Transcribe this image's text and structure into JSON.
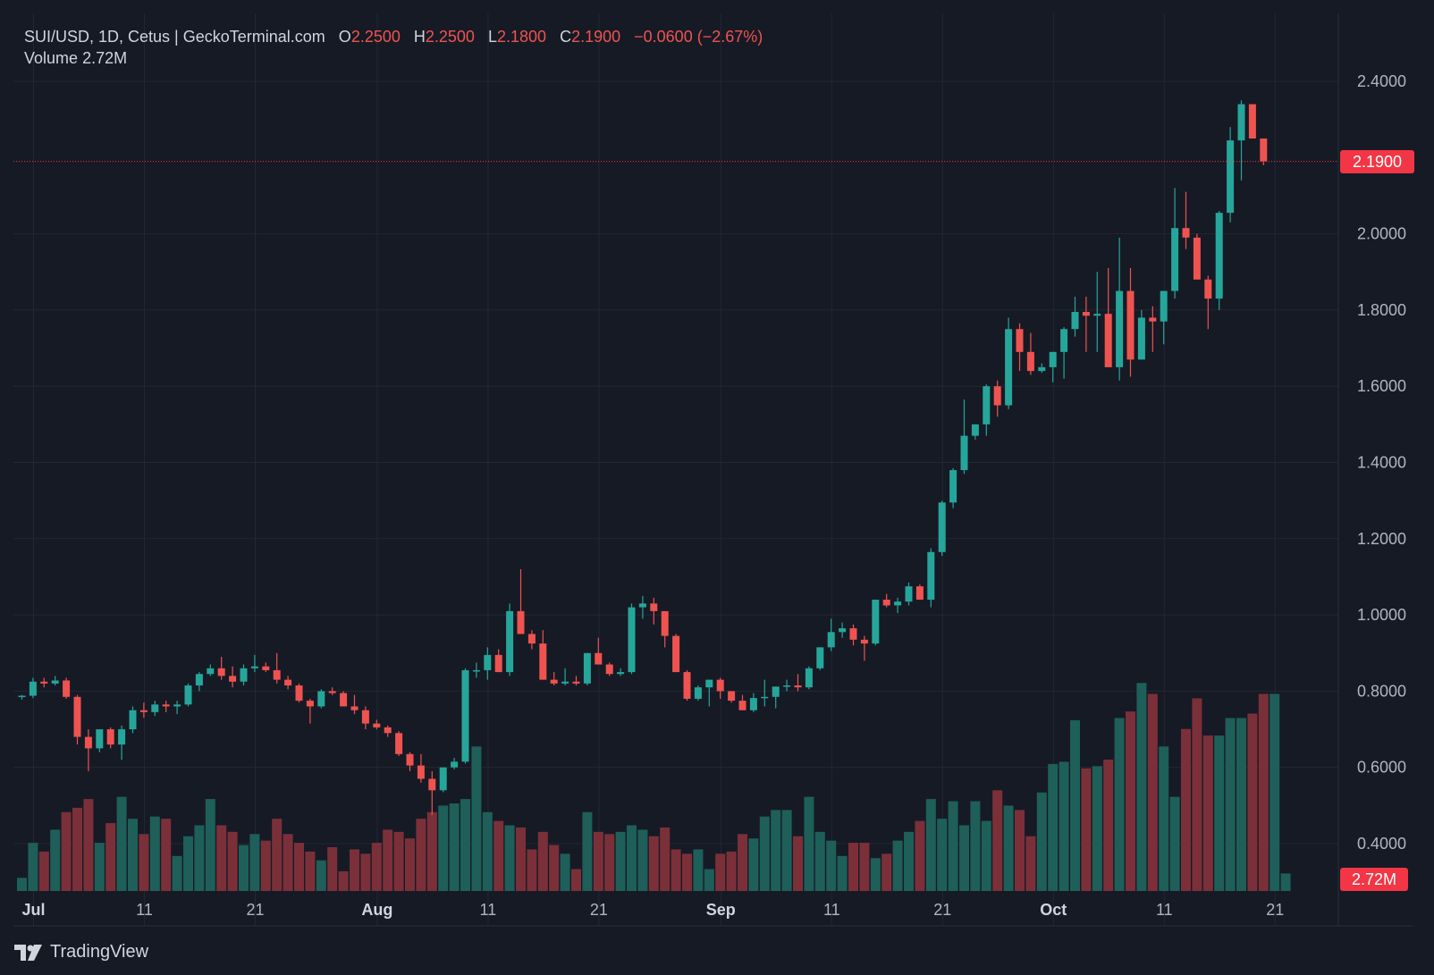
{
  "header": {
    "symbol": "SUI/USD, 1D, Cetus | GeckoTerminal.com",
    "open_label": "O",
    "open": "2.2500",
    "high_label": "H",
    "high": "2.2500",
    "low_label": "L",
    "low": "2.1800",
    "close_label": "C",
    "close": "2.1900",
    "change": "−0.0600 (−2.67%)",
    "volume_label": "Volume",
    "volume": "2.72M"
  },
  "last_price_tag": "2.1900",
  "volume_tag": "2.72M",
  "brand": "TradingView",
  "colors": {
    "background": "#161a25",
    "up": "#26a69a",
    "down": "#ef5350",
    "volume_up": "#1e5f59",
    "volume_down": "#7b3039",
    "grid": "#232733",
    "last_price": "#f23645"
  },
  "chart_data": {
    "type": "candlestick",
    "price_axis": {
      "ticks": [
        "0.4000",
        "0.6000",
        "0.8000",
        "1.0000",
        "1.2000",
        "1.4000",
        "1.6000",
        "1.8000",
        "2.0000",
        "2.4000"
      ],
      "range": [
        0.28,
        2.44
      ]
    },
    "time_axis": {
      "ticks": [
        {
          "label": "Jul",
          "day": 0,
          "bold": true
        },
        {
          "label": "11",
          "day": 10,
          "bold": false
        },
        {
          "label": "21",
          "day": 20,
          "bold": false
        },
        {
          "label": "Aug",
          "day": 31,
          "bold": true
        },
        {
          "label": "11",
          "day": 41,
          "bold": false
        },
        {
          "label": "21",
          "day": 51,
          "bold": false
        },
        {
          "label": "Sep",
          "day": 62,
          "bold": true
        },
        {
          "label": "11",
          "day": 72,
          "bold": false
        },
        {
          "label": "21",
          "day": 82,
          "bold": false
        },
        {
          "label": "Oct",
          "day": 92,
          "bold": true
        },
        {
          "label": "11",
          "day": 102,
          "bold": false
        },
        {
          "label": "21",
          "day": 112,
          "bold": false
        }
      ]
    },
    "candles": [
      [
        0.785,
        0.79,
        0.778,
        0.788
      ],
      [
        0.788,
        0.835,
        0.782,
        0.825
      ],
      [
        0.825,
        0.835,
        0.81,
        0.82
      ],
      [
        0.82,
        0.84,
        0.815,
        0.828
      ],
      [
        0.828,
        0.835,
        0.78,
        0.785
      ],
      [
        0.785,
        0.79,
        0.66,
        0.68
      ],
      [
        0.68,
        0.7,
        0.59,
        0.65
      ],
      [
        0.65,
        0.7,
        0.64,
        0.7
      ],
      [
        0.7,
        0.705,
        0.65,
        0.66
      ],
      [
        0.66,
        0.71,
        0.62,
        0.7
      ],
      [
        0.7,
        0.76,
        0.69,
        0.75
      ],
      [
        0.75,
        0.77,
        0.73,
        0.745
      ],
      [
        0.745,
        0.775,
        0.735,
        0.765
      ],
      [
        0.765,
        0.775,
        0.745,
        0.76
      ],
      [
        0.76,
        0.775,
        0.74,
        0.765
      ],
      [
        0.765,
        0.82,
        0.76,
        0.815
      ],
      [
        0.815,
        0.85,
        0.8,
        0.845
      ],
      [
        0.845,
        0.87,
        0.84,
        0.86
      ],
      [
        0.86,
        0.89,
        0.83,
        0.84
      ],
      [
        0.84,
        0.865,
        0.81,
        0.825
      ],
      [
        0.825,
        0.87,
        0.815,
        0.86
      ],
      [
        0.86,
        0.895,
        0.85,
        0.865
      ],
      [
        0.865,
        0.875,
        0.85,
        0.855
      ],
      [
        0.855,
        0.9,
        0.82,
        0.83
      ],
      [
        0.83,
        0.84,
        0.805,
        0.815
      ],
      [
        0.815,
        0.82,
        0.77,
        0.775
      ],
      [
        0.775,
        0.78,
        0.715,
        0.76
      ],
      [
        0.76,
        0.805,
        0.755,
        0.8
      ],
      [
        0.8,
        0.81,
        0.79,
        0.795
      ],
      [
        0.795,
        0.8,
        0.765,
        0.76
      ],
      [
        0.76,
        0.79,
        0.74,
        0.75
      ],
      [
        0.75,
        0.76,
        0.7,
        0.715
      ],
      [
        0.715,
        0.725,
        0.7,
        0.705
      ],
      [
        0.705,
        0.71,
        0.68,
        0.69
      ],
      [
        0.69,
        0.695,
        0.63,
        0.635
      ],
      [
        0.635,
        0.64,
        0.59,
        0.605
      ],
      [
        0.605,
        0.635,
        0.56,
        0.57
      ],
      [
        0.57,
        0.59,
        0.475,
        0.54
      ],
      [
        0.54,
        0.6,
        0.535,
        0.6
      ],
      [
        0.6,
        0.625,
        0.595,
        0.615
      ],
      [
        0.615,
        0.86,
        0.61,
        0.855
      ],
      [
        0.855,
        0.875,
        0.835,
        0.855
      ],
      [
        0.855,
        0.915,
        0.83,
        0.895
      ],
      [
        0.895,
        0.91,
        0.86,
        0.85
      ],
      [
        0.85,
        1.03,
        0.84,
        1.01
      ],
      [
        1.01,
        1.12,
        0.99,
        0.95
      ],
      [
        0.95,
        0.96,
        0.91,
        0.925
      ],
      [
        0.925,
        0.96,
        0.85,
        0.83
      ],
      [
        0.83,
        0.85,
        0.815,
        0.82
      ],
      [
        0.82,
        0.86,
        0.815,
        0.825
      ],
      [
        0.825,
        0.84,
        0.815,
        0.82
      ],
      [
        0.82,
        0.9,
        0.815,
        0.9
      ],
      [
        0.9,
        0.94,
        0.87,
        0.87
      ],
      [
        0.87,
        0.875,
        0.84,
        0.845
      ],
      [
        0.845,
        0.86,
        0.84,
        0.85
      ],
      [
        0.85,
        1.03,
        0.845,
        1.02
      ],
      [
        1.02,
        1.05,
        0.99,
        1.03
      ],
      [
        1.03,
        1.045,
        0.975,
        1.01
      ],
      [
        1.01,
        1.0,
        0.915,
        0.945
      ],
      [
        0.945,
        0.95,
        0.87,
        0.85
      ],
      [
        0.85,
        0.855,
        0.775,
        0.78
      ],
      [
        0.78,
        0.815,
        0.775,
        0.81
      ],
      [
        0.81,
        0.83,
        0.76,
        0.83
      ],
      [
        0.83,
        0.835,
        0.78,
        0.8
      ],
      [
        0.8,
        0.8,
        0.77,
        0.775
      ],
      [
        0.775,
        0.79,
        0.75,
        0.75
      ],
      [
        0.75,
        0.795,
        0.745,
        0.782
      ],
      [
        0.782,
        0.83,
        0.76,
        0.785
      ],
      [
        0.785,
        0.81,
        0.755,
        0.812
      ],
      [
        0.812,
        0.83,
        0.8,
        0.815
      ],
      [
        0.815,
        0.845,
        0.8,
        0.81
      ],
      [
        0.81,
        0.865,
        0.805,
        0.86
      ],
      [
        0.86,
        0.915,
        0.855,
        0.915
      ],
      [
        0.915,
        0.99,
        0.905,
        0.955
      ],
      [
        0.955,
        0.98,
        0.94,
        0.965
      ],
      [
        0.965,
        0.975,
        0.92,
        0.935
      ],
      [
        0.935,
        0.945,
        0.88,
        0.925
      ],
      [
        0.925,
        1.04,
        0.92,
        1.04
      ],
      [
        1.04,
        1.055,
        1.02,
        1.025
      ],
      [
        1.025,
        1.045,
        1.005,
        1.035
      ],
      [
        1.035,
        1.085,
        1.025,
        1.075
      ],
      [
        1.075,
        1.08,
        1.04,
        1.04
      ],
      [
        1.04,
        1.175,
        1.02,
        1.165
      ],
      [
        1.165,
        1.3,
        1.155,
        1.295
      ],
      [
        1.295,
        1.385,
        1.28,
        1.38
      ],
      [
        1.38,
        1.565,
        1.37,
        1.47
      ],
      [
        1.47,
        1.5,
        1.46,
        1.5
      ],
      [
        1.5,
        1.605,
        1.47,
        1.6
      ],
      [
        1.6,
        1.615,
        1.52,
        1.55
      ],
      [
        1.55,
        1.78,
        1.54,
        1.75
      ],
      [
        1.75,
        1.765,
        1.64,
        1.69
      ],
      [
        1.69,
        1.74,
        1.63,
        1.64
      ],
      [
        1.64,
        1.66,
        1.635,
        1.65
      ],
      [
        1.65,
        1.69,
        1.61,
        1.69
      ],
      [
        1.69,
        1.755,
        1.62,
        1.75
      ],
      [
        1.75,
        1.835,
        1.73,
        1.795
      ],
      [
        1.795,
        1.835,
        1.69,
        1.785
      ],
      [
        1.785,
        1.9,
        1.69,
        1.79
      ],
      [
        1.79,
        1.91,
        1.65,
        1.65
      ],
      [
        1.65,
        1.99,
        1.615,
        1.85
      ],
      [
        1.85,
        1.91,
        1.625,
        1.67
      ],
      [
        1.67,
        1.8,
        1.7,
        1.78
      ],
      [
        1.78,
        1.81,
        1.69,
        1.77
      ],
      [
        1.77,
        1.83,
        1.71,
        1.85
      ],
      [
        1.85,
        2.12,
        1.83,
        2.015
      ],
      [
        2.015,
        2.11,
        1.96,
        1.99
      ],
      [
        1.99,
        2.0,
        1.88,
        1.88
      ],
      [
        1.88,
        1.89,
        1.75,
        1.83
      ],
      [
        1.83,
        2.06,
        1.8,
        2.055
      ],
      [
        2.055,
        2.28,
        2.03,
        2.245
      ],
      [
        2.245,
        2.35,
        2.14,
        2.34
      ],
      [
        2.34,
        2.34,
        2.25,
        2.25
      ],
      [
        2.25,
        2.25,
        2.18,
        2.19
      ]
    ],
    "volumes": [
      0.06,
      0.22,
      0.18,
      0.28,
      0.36,
      0.38,
      0.42,
      0.22,
      0.31,
      0.43,
      0.33,
      0.26,
      0.34,
      0.33,
      0.16,
      0.25,
      0.3,
      0.42,
      0.3,
      0.27,
      0.21,
      0.26,
      0.23,
      0.33,
      0.26,
      0.22,
      0.18,
      0.14,
      0.2,
      0.09,
      0.19,
      0.17,
      0.22,
      0.28,
      0.27,
      0.24,
      0.33,
      0.36,
      0.39,
      0.4,
      0.42,
      0.66,
      0.36,
      0.32,
      0.3,
      0.29,
      0.19,
      0.27,
      0.21,
      0.17,
      0.1,
      0.36,
      0.27,
      0.26,
      0.27,
      0.3,
      0.28,
      0.25,
      0.29,
      0.19,
      0.17,
      0.19,
      0.1,
      0.17,
      0.18,
      0.26,
      0.24,
      0.34,
      0.37,
      0.37,
      0.25,
      0.43,
      0.27,
      0.23,
      0.16,
      0.22,
      0.22,
      0.15,
      0.17,
      0.23,
      0.27,
      0.32,
      0.42,
      0.33,
      0.41,
      0.3,
      0.41,
      0.32,
      0.46,
      0.39,
      0.37,
      0.25,
      0.45,
      0.58,
      0.59,
      0.78,
      0.56,
      0.57,
      0.6,
      0.79,
      0.82,
      0.95,
      0.9,
      0.66,
      0.43,
      0.74,
      0.88,
      0.71,
      0.71,
      0.79,
      0.79,
      0.81,
      0.9,
      0.9,
      0.08
    ],
    "last_price": 2.19
  }
}
